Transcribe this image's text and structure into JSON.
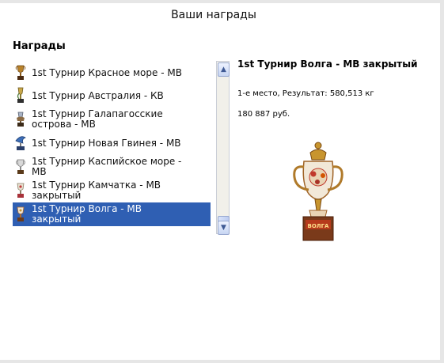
{
  "dialog": {
    "title": "Ваши награды"
  },
  "awards": {
    "heading": "Награды",
    "items": [
      {
        "label": "1st Турнир Красное море - МВ",
        "icon": "trophy-icon"
      },
      {
        "label": "1st Турнир Австралия - КВ",
        "icon": "trophy-icon"
      },
      {
        "label": "1st Турнир Галапагосские острова - МВ",
        "icon": "trophy-icon"
      },
      {
        "label": "1st Турнир Новая Гвинея - МВ",
        "icon": "trophy-icon"
      },
      {
        "label": "1st Турнир Каспийское море - МВ",
        "icon": "trophy-icon"
      },
      {
        "label": "1st Турнир Камчатка - МВ закрытый",
        "icon": "trophy-icon"
      },
      {
        "label": "1st Турнир Волга - МВ закрытый",
        "icon": "trophy-icon",
        "selected": true
      }
    ]
  },
  "detail": {
    "title": "1st Турнир Волга - МВ закрытый",
    "place": "1-е место, Результат: 580,513 кг",
    "prize": "180 887 руб.",
    "plaque": "ВОЛГА"
  },
  "scroll": {
    "up_icon": "scroll-up-icon",
    "down_icon": "scroll-down-icon"
  },
  "colors": {
    "selection": "#2f5fb3",
    "trophy_gold": "#c8952e",
    "plaque_red": "#b63a1c"
  }
}
